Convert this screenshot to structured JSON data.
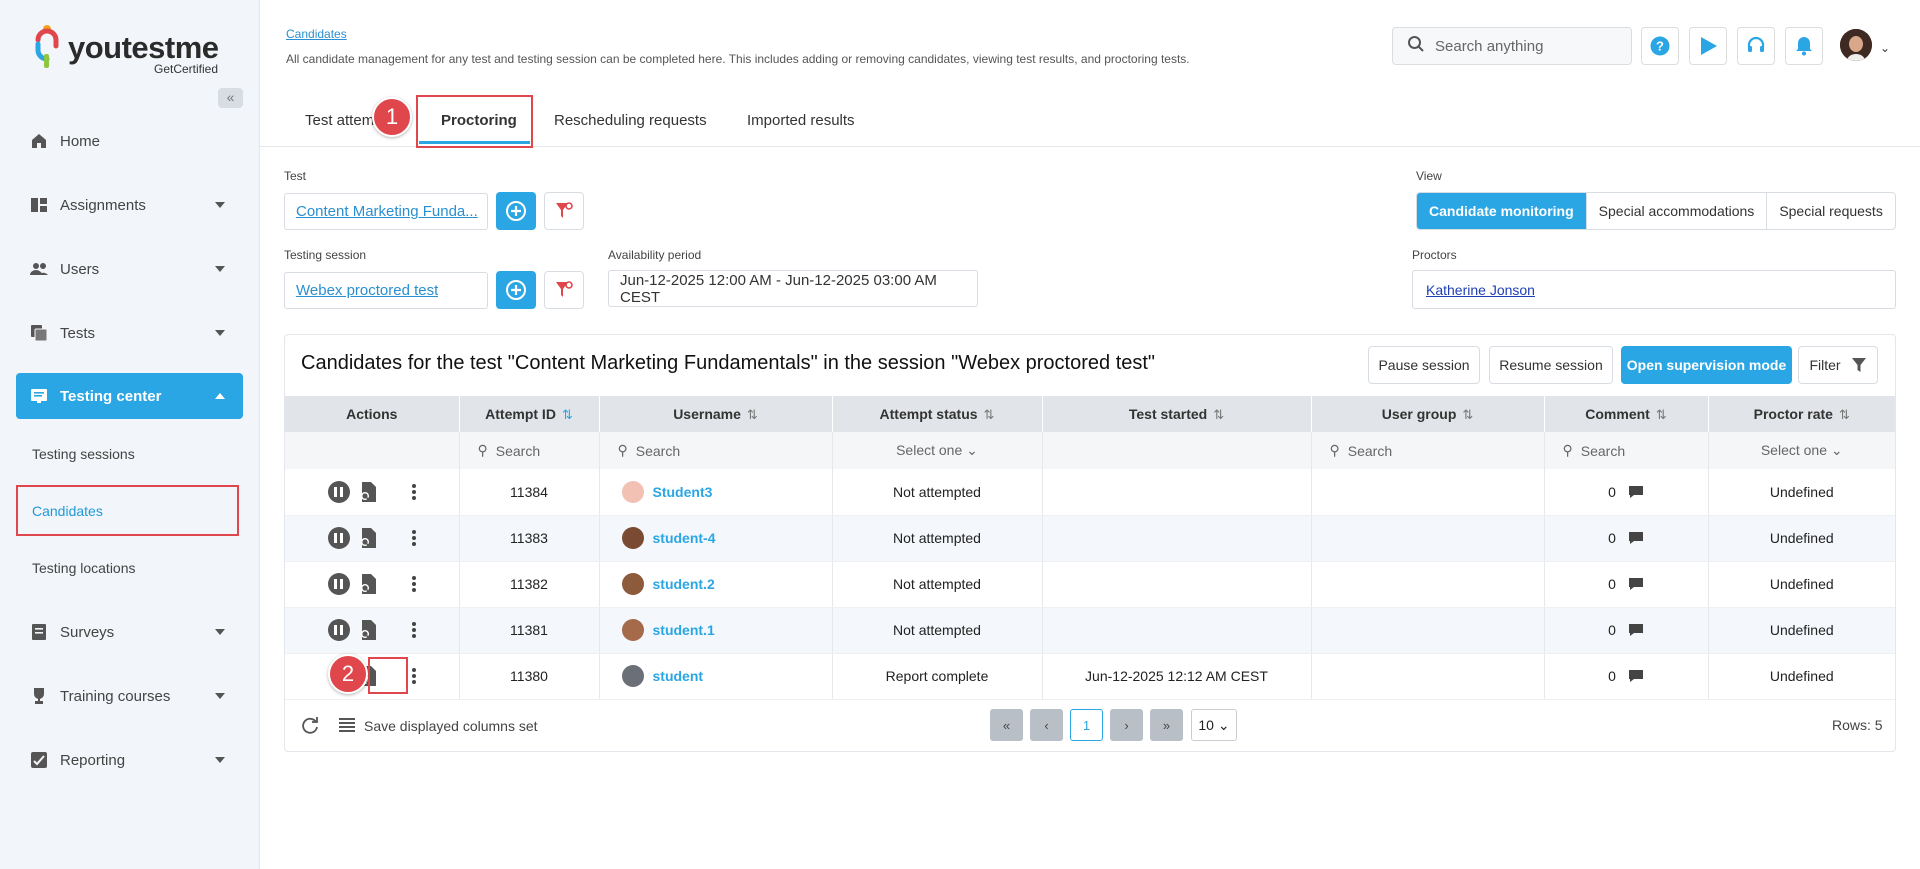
{
  "brand": {
    "name": "youtestme",
    "sub": "GetCertified"
  },
  "sidebar": {
    "items": [
      {
        "label": "Home"
      },
      {
        "label": "Assignments"
      },
      {
        "label": "Users"
      },
      {
        "label": "Tests"
      },
      {
        "label": "Testing center"
      },
      {
        "label": "Surveys"
      },
      {
        "label": "Training courses"
      },
      {
        "label": "Reporting"
      }
    ],
    "subitems": [
      {
        "label": "Testing sessions"
      },
      {
        "label": "Candidates"
      },
      {
        "label": "Testing locations"
      }
    ]
  },
  "header": {
    "breadcrumb": "Candidates",
    "description": "All candidate management for any test and testing session can be completed here. This includes adding or removing candidates, viewing test results, and proctoring tests.",
    "search_placeholder": "Search anything"
  },
  "tabs": [
    {
      "label": "Test attem"
    },
    {
      "label": "Proctoring"
    },
    {
      "label": "Rescheduling requests"
    },
    {
      "label": "Imported results"
    }
  ],
  "markers": [
    "1",
    "2"
  ],
  "filters": {
    "test_label": "Test",
    "test_value": "Content Marketing Funda...",
    "session_label": "Testing session",
    "session_value": "Webex proctored test",
    "availability_label": "Availability period",
    "availability_value": "Jun-12-2025 12:00 AM - Jun-12-2025 03:00 AM CEST",
    "view_label": "View",
    "view_options": [
      "Candidate monitoring",
      "Special accommodations",
      "Special requests"
    ],
    "proctors_label": "Proctors",
    "proctors_value": "Katherine Jonson"
  },
  "panel": {
    "title": "Candidates for the test \"Content Marketing Fundamentals\" in the session \"Webex proctored test\"",
    "pause_label": "Pause session",
    "resume_label": "Resume session",
    "supervise_label": "Open supervision mode",
    "filter_label": "Filter"
  },
  "table": {
    "headers": [
      "Actions",
      "Attempt ID",
      "Username",
      "Attempt status",
      "Test started",
      "User group",
      "Comment",
      "Proctor rate"
    ],
    "search_placeholder": "Search",
    "select_placeholder": "Select one",
    "rows": [
      {
        "id": "11384",
        "user": "Student3",
        "status": "Not attempted",
        "started": "",
        "group": "",
        "comments": "0",
        "rate": "Undefined"
      },
      {
        "id": "11383",
        "user": "student-4",
        "status": "Not attempted",
        "started": "",
        "group": "",
        "comments": "0",
        "rate": "Undefined"
      },
      {
        "id": "11382",
        "user": "student.2",
        "status": "Not attempted",
        "started": "",
        "group": "",
        "comments": "0",
        "rate": "Undefined"
      },
      {
        "id": "11381",
        "user": "student.1",
        "status": "Not attempted",
        "started": "",
        "group": "",
        "comments": "0",
        "rate": "Undefined"
      },
      {
        "id": "11380",
        "user": "student",
        "status": "Report complete",
        "started": "Jun-12-2025 12:12 AM CEST",
        "group": "",
        "comments": "0",
        "rate": "Undefined"
      }
    ]
  },
  "footer": {
    "save_columns": "Save displayed columns set",
    "page": "1",
    "page_size": "10",
    "rows_label": "Rows: 5"
  },
  "colors": {
    "accent": "#2ba6e4",
    "marker": "#e0474c"
  }
}
